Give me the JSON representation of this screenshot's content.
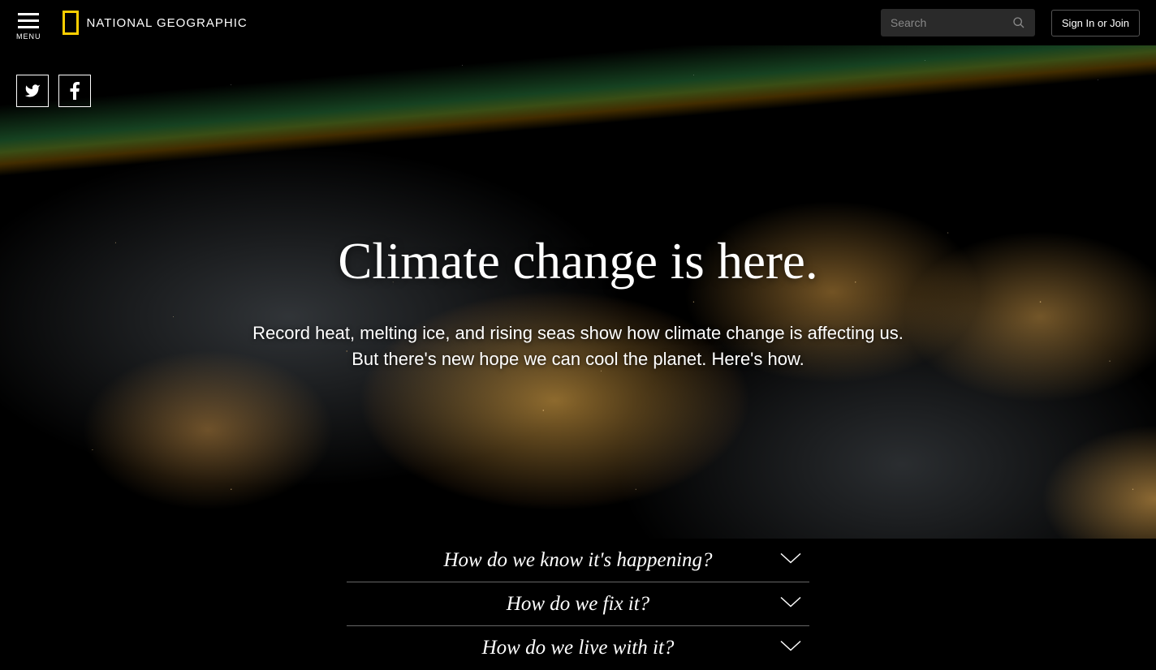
{
  "header": {
    "menu_label": "MENU",
    "brand": "NATIONAL GEOGRAPHIC",
    "search_placeholder": "Search",
    "signin_label": "Sign In or Join"
  },
  "hero": {
    "title": "Climate change is here.",
    "subtitle_line1": "Record heat, melting ice, and rising seas show how climate change is affecting us.",
    "subtitle_line2": "But there's new hope we can cool the planet. Here's how."
  },
  "accordion": {
    "items": [
      {
        "label": "How do we know it's happening?"
      },
      {
        "label": "How do we fix it?"
      },
      {
        "label": "How do we live with it?"
      }
    ]
  },
  "social": {
    "twitter": "twitter-icon",
    "facebook": "facebook-icon"
  }
}
